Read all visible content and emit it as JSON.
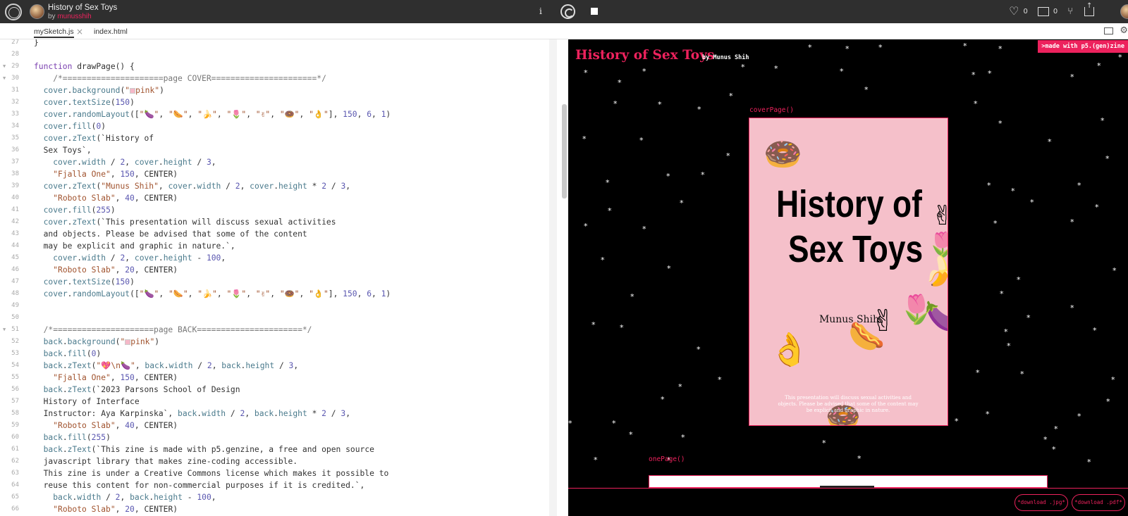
{
  "header": {
    "sketch_title": "History of Sex Toys",
    "by_label": "by",
    "username": "munusshih",
    "info_label": "i",
    "likes": "0",
    "collections": "0"
  },
  "tabs": [
    {
      "label": "mySketch.js",
      "close": "×"
    },
    {
      "label": "index.html"
    }
  ],
  "editor": {
    "lines": [
      {
        "n": "27",
        "fold": false
      },
      {
        "n": "28",
        "fold": false
      },
      {
        "n": "29",
        "fold": true
      },
      {
        "n": "30",
        "fold": true
      },
      {
        "n": "31"
      },
      {
        "n": "32"
      },
      {
        "n": "33"
      },
      {
        "n": "34"
      },
      {
        "n": "35"
      },
      {
        "n": "36"
      },
      {
        "n": "37"
      },
      {
        "n": "38"
      },
      {
        "n": "39"
      },
      {
        "n": "40"
      },
      {
        "n": "41"
      },
      {
        "n": "42"
      },
      {
        "n": "43"
      },
      {
        "n": "44"
      },
      {
        "n": "45"
      },
      {
        "n": "46"
      },
      {
        "n": "47"
      },
      {
        "n": "48"
      },
      {
        "n": "49"
      },
      {
        "n": "50"
      },
      {
        "n": "51",
        "fold": true
      },
      {
        "n": "52"
      },
      {
        "n": "53"
      },
      {
        "n": "54"
      },
      {
        "n": "55"
      },
      {
        "n": "56"
      },
      {
        "n": "57"
      },
      {
        "n": "58"
      },
      {
        "n": "59"
      },
      {
        "n": "60"
      },
      {
        "n": "61"
      },
      {
        "n": "62"
      },
      {
        "n": "63"
      },
      {
        "n": "64"
      },
      {
        "n": "65"
      },
      {
        "n": "66"
      }
    ]
  },
  "preview": {
    "zine_title": "History of Sex Toys",
    "zine_by": "by Munus Shih",
    "made_with": ">made with p5.(gen)zine",
    "cover_label": "coverPage()",
    "cover_title_line1": "History of",
    "cover_title_line2": "Sex Toys",
    "cover_author": "Munus Shih",
    "cover_notice": "This presentation will discuss sexual activities and objects. Please be advised that some of the content may be explicit and graphic in nature.",
    "one_page_label": "onePage()",
    "download_jpg": "*download .jpg*",
    "download_pdf": "*download .pdf*"
  },
  "colors": {
    "accent": "#ed225d",
    "topbar_bg": "#2f2f2f",
    "cover_bg": "#f5c0ca",
    "preview_bg": "#000000"
  },
  "icons": [
    "logo-icon",
    "info-icon",
    "play-icon",
    "stop-icon",
    "heart-icon",
    "collection-icon",
    "fork-icon",
    "share-icon",
    "layout-icon",
    "settings-icon"
  ]
}
